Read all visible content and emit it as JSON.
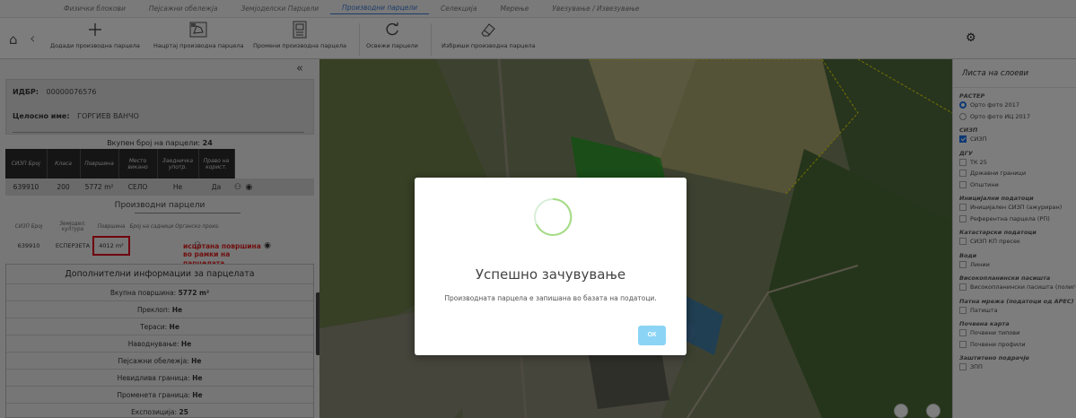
{
  "tabs": [
    {
      "label": "Физички блокови",
      "active": false
    },
    {
      "label": "Пејсажни обележја",
      "active": false
    },
    {
      "label": "Земјоделски Парцели",
      "active": false
    },
    {
      "label": "Производни парцели",
      "active": true
    },
    {
      "label": "Селекција",
      "active": false
    },
    {
      "label": "Мерење",
      "active": false
    },
    {
      "label": "Увезување / Извезување",
      "active": false
    }
  ],
  "toolbar": {
    "add": "Додади производна парцела",
    "draw": "Нацртај производна парцела",
    "change": "Промени производна парцела",
    "refresh": "Освежи парцели",
    "delete": "Избриши производна парцела"
  },
  "owner": {
    "idbr_label": "ИДБР:",
    "idbr_value": "00000076576",
    "name_label": "Целосно име:",
    "name_value": "ГОРГИЕВ ВАНЧО"
  },
  "parcels": {
    "total_prefix": "Вкупен број на парцели:",
    "total_value": "24",
    "columns": [
      "СИЗП Број",
      "Класа",
      "Површина",
      "Место викано",
      "Заедничка употр.",
      "Право на корист."
    ],
    "row": {
      "sizp": "639910",
      "klasa": "200",
      "area": "5772 m²",
      "place": "СЕЛО",
      "shared": "Не",
      "right": "Да"
    }
  },
  "production": {
    "title": "Производни парцели",
    "columns": [
      "СИЗП Број",
      "Земјодел. култура",
      "Површина",
      "Број на садници",
      "Органско произ."
    ],
    "row": {
      "sizp": "639910",
      "culture": "ЕСПЕРЗЕТА",
      "area": "4012 m²"
    },
    "annotation": "исцртана површина во рамки на парцелата"
  },
  "info": {
    "header": "Дополнителни информации за парцелата",
    "lines": [
      {
        "label": "Вкупна површина:",
        "value": "5772 m²"
      },
      {
        "label": "Преклоп:",
        "value": "Не"
      },
      {
        "label": "Тераси:",
        "value": "Не"
      },
      {
        "label": "Наводнување:",
        "value": "Не"
      },
      {
        "label": "Пејсажни обележја:",
        "value": "Не"
      },
      {
        "label": "Невидлива граница:",
        "value": "Не"
      },
      {
        "label": "Променета граница:",
        "value": "Не"
      },
      {
        "label": "Експозиција:",
        "value": "25"
      }
    ]
  },
  "layers": {
    "header": "Листа на слоеви",
    "groups": [
      {
        "title": "РАСТЕР",
        "items": [
          {
            "label": "Орто фото 2017",
            "type": "radio",
            "checked": true
          },
          {
            "label": "Орто фото ИЦ 2017",
            "type": "radio",
            "checked": false
          }
        ]
      },
      {
        "title": "СИЗП",
        "items": [
          {
            "label": "СИЗП",
            "type": "check",
            "checked": true
          }
        ]
      },
      {
        "title": "ДГУ",
        "items": [
          {
            "label": "ТК 25",
            "type": "check",
            "checked": false
          },
          {
            "label": "Државни граници",
            "type": "check",
            "checked": false
          },
          {
            "label": "Општини",
            "type": "check",
            "checked": false
          }
        ]
      },
      {
        "title": "Иницијални податоци",
        "items": [
          {
            "label": "Иницијален СИЗП (ажуриран)",
            "type": "check",
            "checked": false
          },
          {
            "label": "Референтна парцела (РП)",
            "type": "check",
            "checked": false
          }
        ]
      },
      {
        "title": "Катастарски податоци",
        "items": [
          {
            "label": "СИЗП КП пресек",
            "type": "check",
            "checked": false
          }
        ]
      },
      {
        "title": "Води",
        "items": [
          {
            "label": "Линии",
            "type": "check",
            "checked": false
          }
        ]
      },
      {
        "title": "Високопланински пасишта",
        "items": [
          {
            "label": "Високопланински пасишта (полиго",
            "type": "check",
            "checked": false
          }
        ]
      },
      {
        "title": "Патна мрежа (податоци од АРЕС)",
        "items": [
          {
            "label": "Патишта",
            "type": "check",
            "checked": false
          }
        ]
      },
      {
        "title": "Почвена карта",
        "items": [
          {
            "label": "Почвени типови",
            "type": "check",
            "checked": false
          },
          {
            "label": "Почвени профили",
            "type": "check",
            "checked": false
          }
        ]
      },
      {
        "title": "Заштитено подрачје",
        "items": [
          {
            "label": "ЗПП",
            "type": "check",
            "checked": false
          }
        ]
      }
    ]
  },
  "modal": {
    "title": "Успешно зачувување",
    "message": "Производната парцела е запишана во базата на податоци.",
    "ok": "ОК"
  },
  "colors": {
    "accent": "#3a7bd5",
    "annotation": "#e02020",
    "parcel_fill": "#22aa22",
    "ok_button": "#8cd4f5"
  }
}
